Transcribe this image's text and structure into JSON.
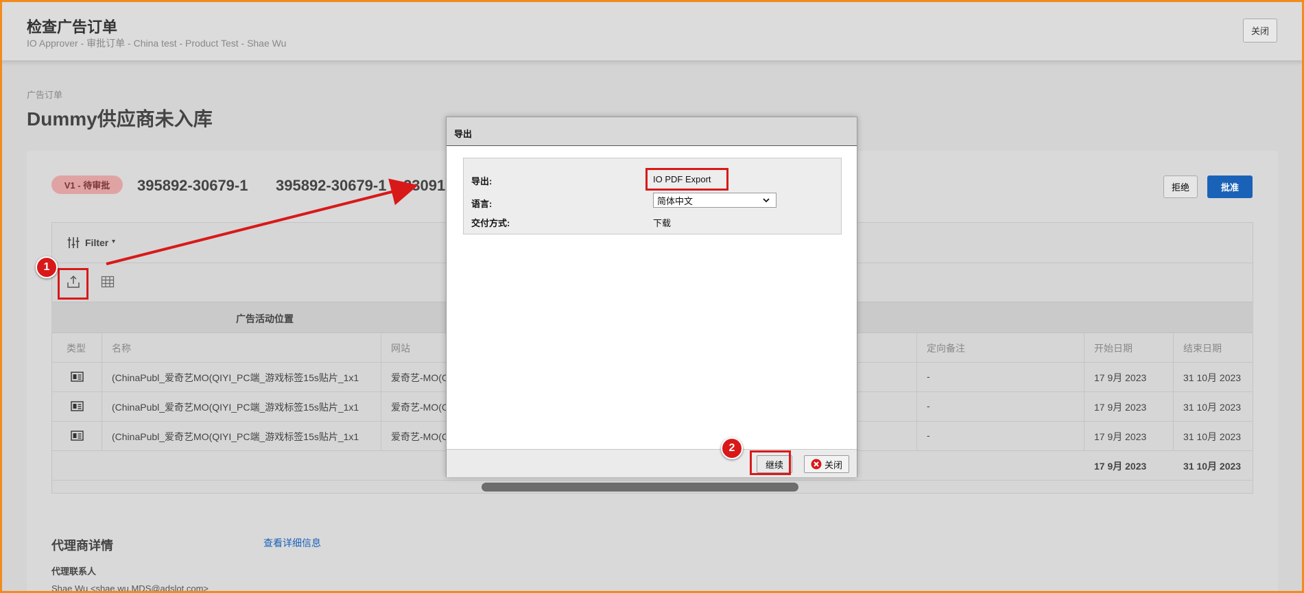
{
  "header": {
    "title": "检查广告订单",
    "subtitle": "IO Approver - 审批订单 - China test - Product Test - Shae Wu",
    "close_label": "关闭"
  },
  "page": {
    "breadcrumb": "广告订单",
    "title": "Dummy供应商未入库"
  },
  "order": {
    "status_badge": "V1 - 待审批",
    "id_1": "395892-30679-1",
    "id_2": "395892-30679-1",
    "id_3_partial": "23091",
    "reject_label": "拒绝",
    "approve_label": "批准"
  },
  "toolbar": {
    "filter_label": "Filter",
    "filter_caret": "▾"
  },
  "table": {
    "group_header": "广告活动位置",
    "columns": {
      "type": "类型",
      "name": "名称",
      "site": "网站",
      "targeting_notes": "定向备注",
      "start_date": "开始日期",
      "end_date": "结束日期"
    },
    "rows": [
      {
        "name": "(ChinaPubl_爱奇艺MO(QIYI_PC端_游戏标签15s贴片_1x1",
        "site": "爱奇艺-MO(C",
        "notes": "-",
        "start": "17 9月 2023",
        "end": "31 10月 2023"
      },
      {
        "name": "(ChinaPubl_爱奇艺MO(QIYI_PC端_游戏标签15s贴片_1x1",
        "site": "爱奇艺-MO(C",
        "notes": "-",
        "start": "17 9月 2023",
        "end": "31 10月 2023"
      },
      {
        "name": "(ChinaPubl_爱奇艺MO(QIYI_PC端_游戏标签15s贴片_1x1",
        "site": "爱奇艺-MO(C",
        "notes": "-",
        "start": "17 9月 2023",
        "end": "31 10月 2023"
      }
    ],
    "total": {
      "start": "17 9月 2023",
      "end": "31 10月 2023"
    }
  },
  "agency": {
    "title": "代理商详情",
    "link": "查看详细信息",
    "contact_label": "代理联系人",
    "contact_value": "Shae Wu <shae.wu.MDS@adslot.com>"
  },
  "modal": {
    "title": "导出",
    "export_label": "导出:",
    "export_value": "IO PDF Export",
    "language_label": "语言:",
    "language_value": "简体中文",
    "delivery_label": "交付方式:",
    "delivery_value": "下载",
    "continue_label": "继续",
    "close_label": "关闭"
  },
  "annotations": {
    "step1": "1",
    "step2": "2",
    "highlight_color": "#d81919"
  },
  "colors": {
    "approve_bg": "#1a62b8",
    "badge_bg": "#e0a3a3",
    "frame": "#f28a1e"
  }
}
